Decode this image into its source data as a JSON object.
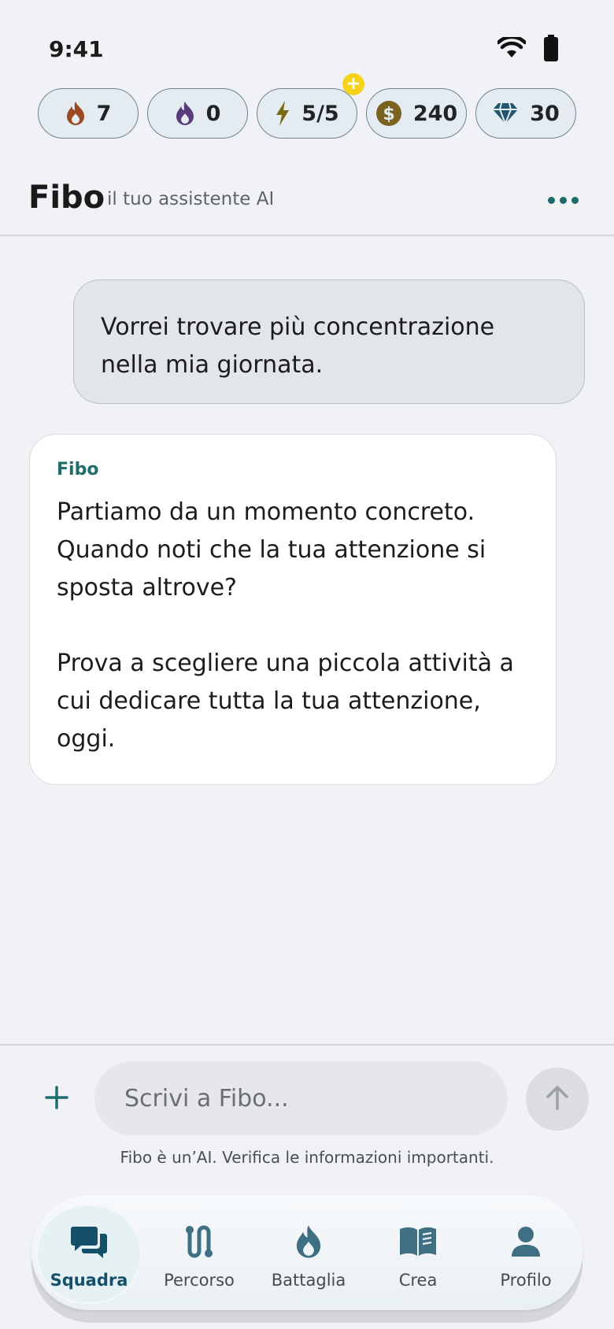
{
  "status_bar": {
    "time": "9:41",
    "wifi_icon": "wifi-icon",
    "battery_icon": "battery-icon"
  },
  "stats": [
    {
      "icon": "flame-icon",
      "color": "#9c4a22",
      "value": "7"
    },
    {
      "icon": "flame-icon",
      "color": "#5b3c7a",
      "value": "0"
    },
    {
      "icon": "bolt-icon",
      "color": "#7a6a16",
      "value": "5/5",
      "badge": "+"
    },
    {
      "icon": "coin-icon",
      "color": "#7a6320",
      "value": "240"
    },
    {
      "icon": "gem-icon",
      "color": "#22566e",
      "value": "30"
    }
  ],
  "header": {
    "title": "Fibo",
    "subtitle": "il tuo assistente AI"
  },
  "messages": {
    "user": "Vorrei trovare più concentrazione nella mia giornata.",
    "ai": {
      "sender": "Fibo",
      "paragraph1": "Partiamo da un momento concreto. Quando noti che la tua attenzione si sposta altrove?",
      "paragraph2": "Prova a scegliere una piccola attività a cui dedicare tutta la tua attenzione, oggi."
    }
  },
  "composer": {
    "placeholder": "Scrivi a Fibo...",
    "disclaimer": "Fibo è un’AI. Verifica le informazioni importanti."
  },
  "nav": {
    "items": [
      {
        "label": "Squadra",
        "icon": "chat-icon",
        "active": true
      },
      {
        "label": "Percorso",
        "icon": "path-icon",
        "active": false
      },
      {
        "label": "Battaglia",
        "icon": "flame-icon",
        "active": false
      },
      {
        "label": "Crea",
        "icon": "book-icon",
        "active": false
      },
      {
        "label": "Profilo",
        "icon": "person-icon",
        "active": false
      }
    ]
  },
  "colors": {
    "accent": "#1f6d6b",
    "nav_active": "#15506b",
    "background": "#f1f2f6"
  }
}
